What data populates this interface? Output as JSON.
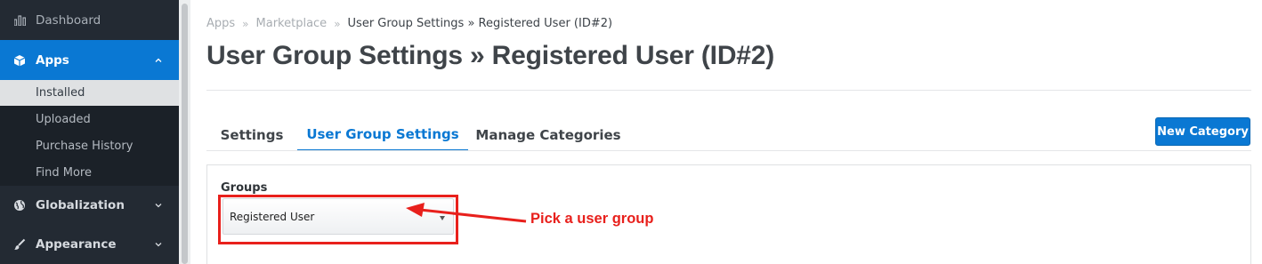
{
  "sidebar": {
    "items": [
      {
        "label": "Dashboard",
        "icon": "chart-bars-icon"
      },
      {
        "label": "Apps",
        "icon": "cube-icon"
      },
      {
        "label": "Globalization",
        "icon": "globe-icon"
      },
      {
        "label": "Appearance",
        "icon": "brush-icon"
      }
    ],
    "apps_sub": [
      "Installed",
      "Uploaded",
      "Purchase History",
      "Find More"
    ]
  },
  "breadcrumb": [
    "Apps",
    "Marketplace",
    "User Group Settings » Registered User (ID#2)"
  ],
  "breadcrumb_sep": "»",
  "page_title": "User Group Settings » Registered User (ID#2)",
  "tabs": [
    {
      "label": "Settings"
    },
    {
      "label": "User Group Settings",
      "active": true
    },
    {
      "label": "Manage Categories"
    }
  ],
  "new_category_label": "New Category",
  "form": {
    "groups_label": "Groups",
    "selected_group": "Registered User"
  },
  "annotation": "Pick a user group",
  "colors": {
    "accent": "#0a78d3",
    "sidebar_bg": "#232a33",
    "annotation_red": "#e8201c"
  }
}
